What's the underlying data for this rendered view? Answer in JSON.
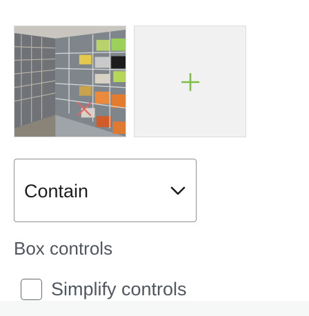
{
  "image_gallery": {
    "photo_icon": "warehouse-shelves-photo",
    "remove_icon": "close-icon",
    "remove_color": "#e06666",
    "add_icon": "plus-icon",
    "add_color": "#7ac142"
  },
  "fit_select": {
    "selected_value": "Contain",
    "icon": "chevron-down-icon"
  },
  "box_controls": {
    "heading": "Box controls",
    "simplify_label": "Simplify controls",
    "simplify_checked": false
  }
}
